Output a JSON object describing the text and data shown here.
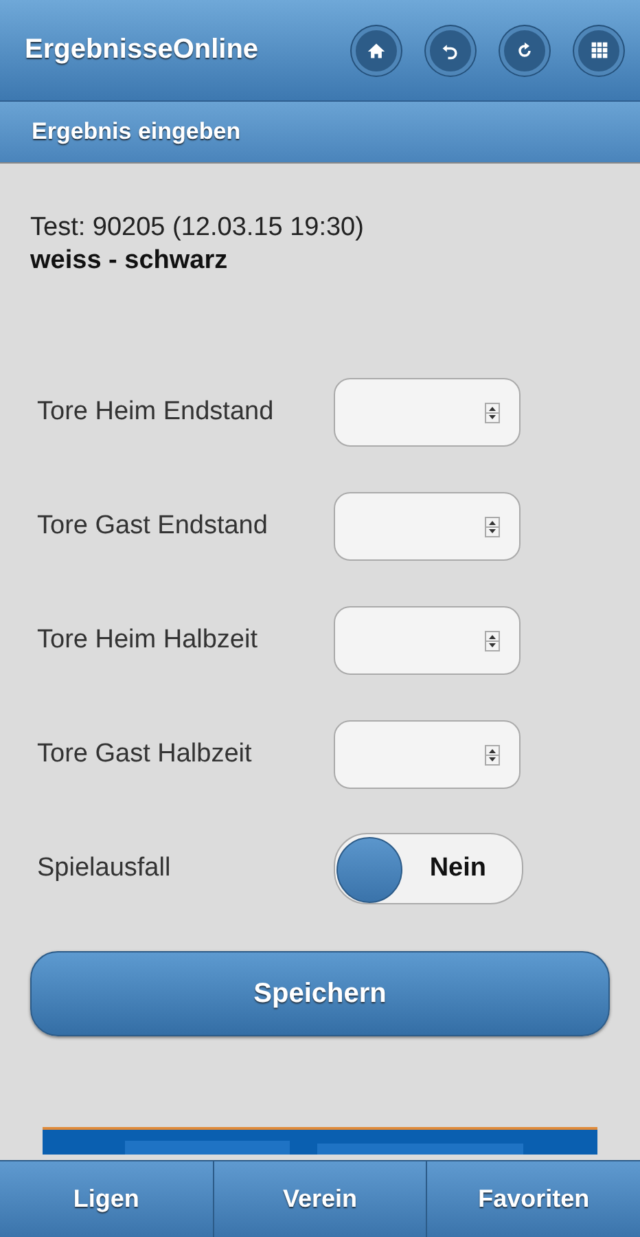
{
  "header": {
    "title": "ErgebnisseOnline",
    "icons": [
      {
        "kind": "home"
      },
      {
        "kind": "back"
      },
      {
        "kind": "refresh"
      },
      {
        "kind": "grid"
      }
    ]
  },
  "subheader": {
    "title": "Ergebnis eingeben"
  },
  "match": {
    "info": "Test: 90205 (12.03.15 19:30)",
    "teams": "weiss - schwarz"
  },
  "fields": [
    {
      "label": "Tore Heim Endstand"
    },
    {
      "label": "Tore Gast Endstand"
    },
    {
      "label": "Tore Heim Halbzeit"
    },
    {
      "label": "Tore Gast Halbzeit"
    }
  ],
  "switch": {
    "label": "Spielausfall",
    "on": false,
    "state_text": "Nein"
  },
  "save_button": "Speichern",
  "banner": {
    "kind": "picture"
  },
  "nav": [
    "Ligen",
    "Verein",
    "Favoriten"
  ]
}
